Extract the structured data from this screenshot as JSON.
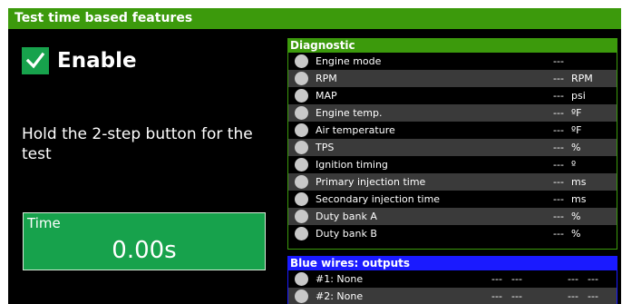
{
  "window": {
    "title": "Test time based features"
  },
  "enable": {
    "label": "Enable",
    "checked": true,
    "icon": "checkmark-icon"
  },
  "instruction": "Hold the 2-step button for the test",
  "time": {
    "label": "Time",
    "value": "0.00s"
  },
  "diagnostic": {
    "title": "Diagnostic",
    "rows": [
      {
        "label": "Engine mode",
        "value": "---",
        "unit": ""
      },
      {
        "label": "RPM",
        "value": "---",
        "unit": "RPM"
      },
      {
        "label": "MAP",
        "value": "---",
        "unit": "psi"
      },
      {
        "label": "Engine temp.",
        "value": "---",
        "unit": "ºF"
      },
      {
        "label": "Air temperature",
        "value": "---",
        "unit": "ºF"
      },
      {
        "label": "TPS",
        "value": "---",
        "unit": "%"
      },
      {
        "label": "Ignition timing",
        "value": "---",
        "unit": "º"
      },
      {
        "label": "Primary injection time",
        "value": "---",
        "unit": "ms"
      },
      {
        "label": "Secondary injection time",
        "value": "---",
        "unit": "ms"
      },
      {
        "label": "Duty bank A",
        "value": "---",
        "unit": "%"
      },
      {
        "label": "Duty bank B",
        "value": "---",
        "unit": "%"
      }
    ]
  },
  "blue_wires": {
    "title": "Blue wires: outputs",
    "rows": [
      {
        "label": "#1: None",
        "v1": "---",
        "v2": "---",
        "v3": "---",
        "v4": "---"
      },
      {
        "label": "#2: None",
        "v1": "---",
        "v2": "---",
        "v3": "---",
        "v4": "---"
      }
    ]
  },
  "colors": {
    "accent_green": "#3c9a0c",
    "time_green": "#17a24c",
    "blue": "#1a1aff"
  }
}
